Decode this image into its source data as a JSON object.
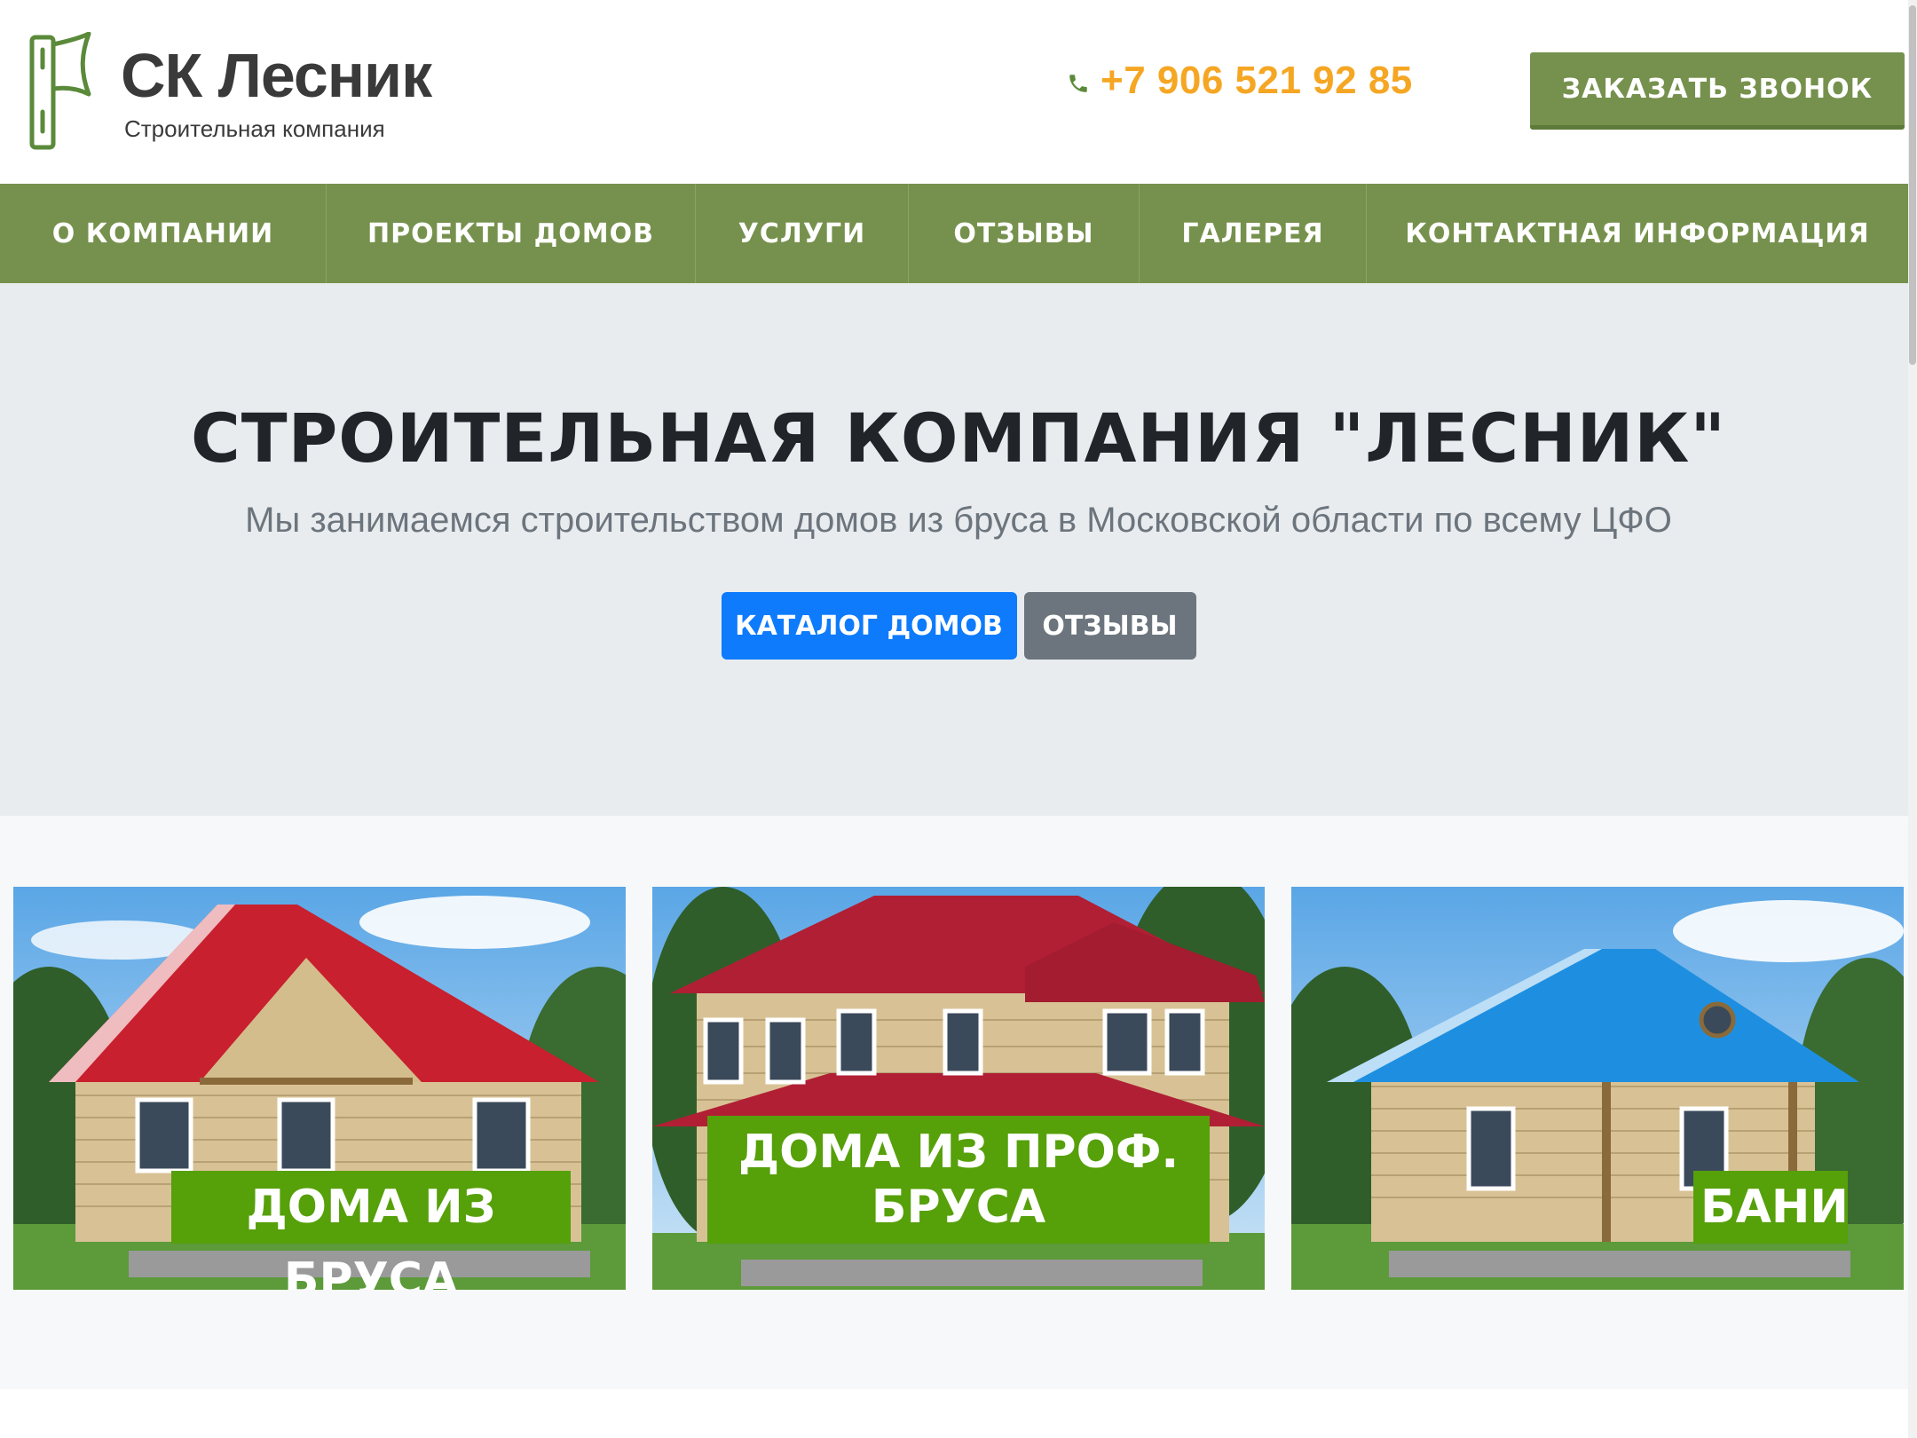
{
  "header": {
    "logo_title": "СК Лесник",
    "logo_subtitle": "Строительная компания",
    "phone": "+7 906 521 92 85",
    "callback_button": "ЗАКАЗАТЬ ЗВОНОК"
  },
  "nav": {
    "items": [
      {
        "label": "О КОМПАНИИ"
      },
      {
        "label": "ПРОЕКТЫ ДОМОВ"
      },
      {
        "label": "УСЛУГИ"
      },
      {
        "label": "ОТЗЫВЫ"
      },
      {
        "label": "ГАЛЕРЕЯ"
      },
      {
        "label": "КОНТАКТНАЯ ИНФОРМАЦИЯ"
      }
    ]
  },
  "hero": {
    "title": "СТРОИТЕЛЬНАЯ КОМПАНИЯ \"ЛЕСНИК\"",
    "subtitle": "Мы занимаемся строительством домов из бруса в Московской области по всему ЦФО",
    "primary_button": "КАТАЛОГ ДОМОВ",
    "secondary_button": "ОТЗЫВЫ"
  },
  "cards": [
    {
      "label": "ДОМА ИЗ БРУСА",
      "roof_color": "#c8202e"
    },
    {
      "label_line1": "ДОМА ИЗ ПРОФ.",
      "label_line2": "БРУСА",
      "roof_color": "#b11f35"
    },
    {
      "label": "БАНИ",
      "roof_color": "#1e8fe0"
    }
  ],
  "colors": {
    "brand_green": "#76914d",
    "label_green": "#56a00a",
    "phone_orange": "#f5a623",
    "primary_blue": "#0d7bfc",
    "secondary_gray": "#6c757d"
  },
  "icons": {
    "logo": "axe-logo-icon",
    "phone": "phone-icon"
  }
}
